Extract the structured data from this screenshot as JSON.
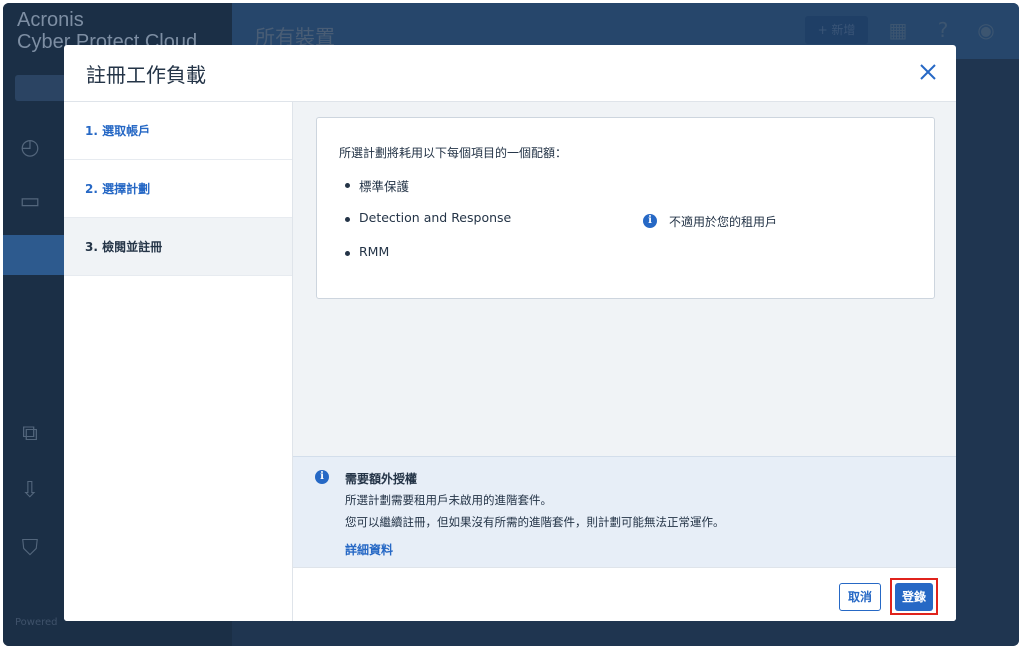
{
  "background_app": {
    "brand_line1": "Acronis",
    "brand_line2": "Cyber Protect Cloud",
    "page_title": "所有裝置",
    "new_button": "+ 新增",
    "powered": "Powered"
  },
  "dialog": {
    "title": "註冊工作負載",
    "close_icon": "close-icon",
    "steps": [
      {
        "label": "1. 選取帳戶",
        "state": "link"
      },
      {
        "label": "2. 選擇計劃",
        "state": "link"
      },
      {
        "label": "3. 檢閱並註冊",
        "state": "current"
      }
    ],
    "quota_card": {
      "intro": "所選計劃將耗用以下每個項目的一個配額：",
      "items": [
        {
          "label": "標準保護"
        },
        {
          "label": "Detection and Response",
          "note": "不適用於您的租用戶"
        },
        {
          "label": "RMM"
        }
      ]
    },
    "notice": {
      "title": "需要額外授權",
      "line1": "所選計劃需要租用戶未啟用的進階套件。",
      "line2": "您可以繼續註冊，但如果沒有所需的進階套件，則計劃可能無法正常運作。",
      "link": "詳細資料"
    },
    "footer": {
      "cancel_label": "取消",
      "register_label": "登錄"
    }
  },
  "colors": {
    "accent": "#2668c5",
    "highlight_border": "#e0231c",
    "overlay": "#1c3048"
  }
}
